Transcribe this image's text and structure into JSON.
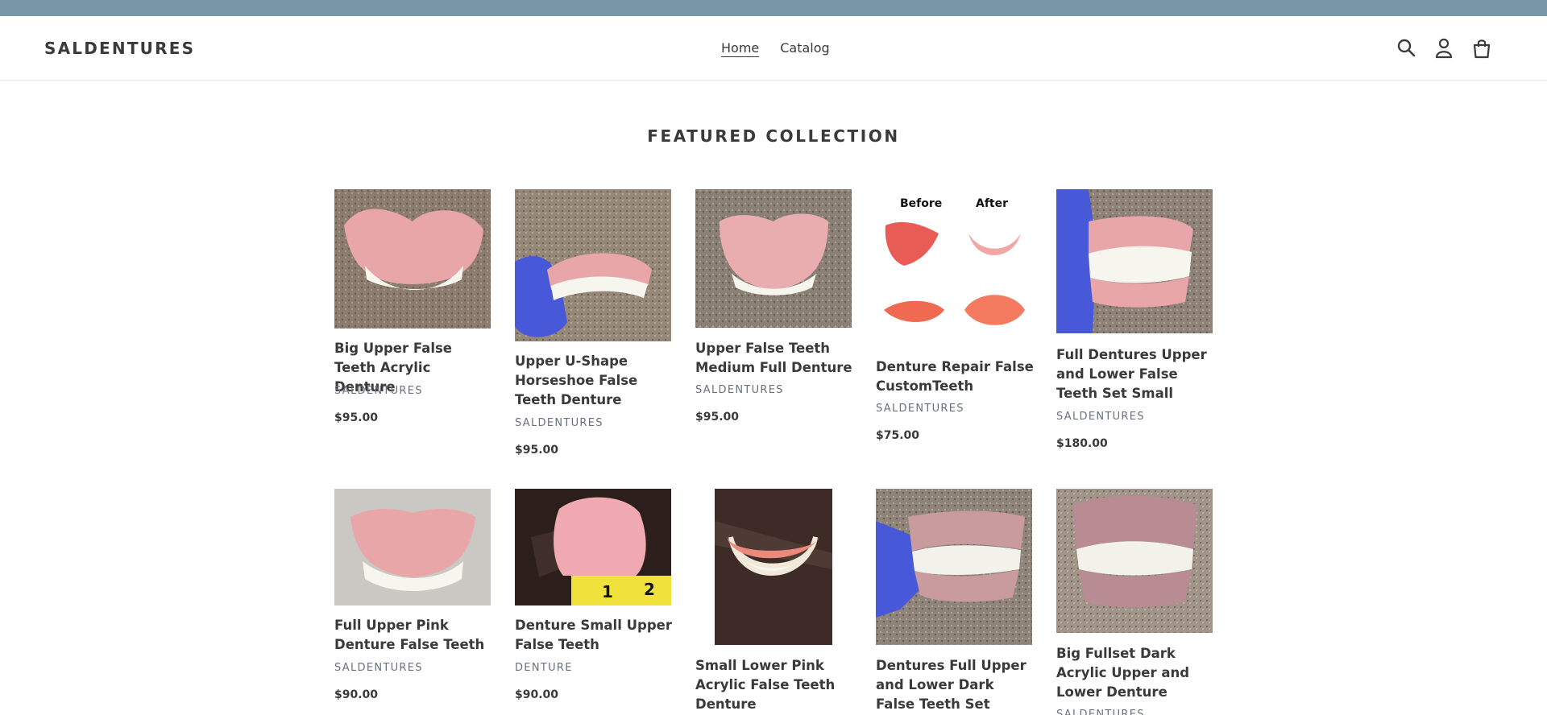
{
  "store": {
    "name": "SALDENTURES"
  },
  "nav": {
    "home": "Home",
    "catalog": "Catalog"
  },
  "icons": {
    "search": "search-icon",
    "account": "account-icon",
    "cart": "cart-icon"
  },
  "section": {
    "title": "FEATURED COLLECTION"
  },
  "image_labels": {
    "before": "Before",
    "after": "After"
  },
  "products": [
    {
      "title": "Big Upper False Teeth Acrylic Denture",
      "vendor": "SALDENTURES",
      "price": "$95.00"
    },
    {
      "title": "Upper U-Shape Horseshoe False Teeth Denture",
      "vendor": "SALDENTURES",
      "price": "$95.00"
    },
    {
      "title": "Upper False Teeth Medium Full Denture",
      "vendor": "SALDENTURES",
      "price": "$95.00"
    },
    {
      "title": "Denture Repair False CustomTeeth",
      "vendor": "SALDENTURES",
      "price": "$75.00"
    },
    {
      "title": "Full Dentures Upper and Lower False Teeth Set Small",
      "vendor": "SALDENTURES",
      "price": "$180.00"
    },
    {
      "title": "Full Upper Pink Denture False Teeth",
      "vendor": "SALDENTURES",
      "price": "$90.00"
    },
    {
      "title": "Denture Small Upper False Teeth",
      "vendor": "DENTURE",
      "price": "$90.00"
    },
    {
      "title": "Small Lower Pink Acrylic False Teeth Denture",
      "vendor": "",
      "price": ""
    },
    {
      "title": "Dentures Full Upper and Lower Dark False Teeth Set Small",
      "vendor": "",
      "price": ""
    },
    {
      "title": "Big Fullset Dark Acrylic Upper and Lower Denture",
      "vendor": "SALDENTURES",
      "price": ""
    }
  ],
  "colors": {
    "announcement_bar": "#7796a8",
    "text": "#3a3a3a",
    "vendor": "#69727b",
    "denture_pink": "#e9a6a8",
    "glove_blue": "#4758d8"
  }
}
